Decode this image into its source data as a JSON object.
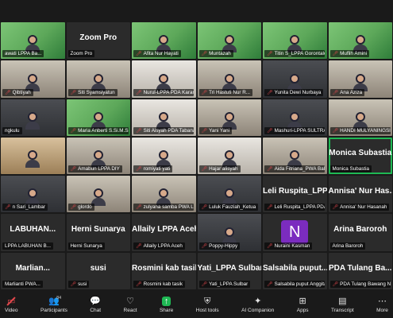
{
  "toolbar": {
    "video": "Video",
    "participants": "Participants",
    "participant_count": "84",
    "chat": "Chat",
    "react": "React",
    "share": "Share",
    "host_tools": "Host tools",
    "ai_companion": "AI Companion",
    "apps": "Apps",
    "transcript": "Transcript",
    "more": "More"
  },
  "tiles": [
    {
      "label": "awati LPPA Ba...",
      "muted": false,
      "style": "vid-green"
    },
    {
      "label": "Zoom Pro",
      "muted": false,
      "style": "text",
      "big": "Zoom Pro"
    },
    {
      "label": "Afita Nur Hayati",
      "muted": true,
      "style": "vid-green"
    },
    {
      "label": "Muntazah",
      "muted": true,
      "style": "vid-green"
    },
    {
      "label": "Titin S_LPPA Gorontalo",
      "muted": true,
      "style": "vid-green"
    },
    {
      "label": "Muflih Amini",
      "muted": true,
      "style": "vid-green"
    },
    {
      "label": "Qibtiyah",
      "muted": true,
      "style": "vid-room"
    },
    {
      "label": "Siti Syamsiyatun",
      "muted": true,
      "style": "vid-room"
    },
    {
      "label": "Nurul-LPPA PDA Karan...",
      "muted": true,
      "style": "vid-light"
    },
    {
      "label": "Tri Hastuti Nur R...",
      "muted": true,
      "style": "vid-room"
    },
    {
      "label": "Yunita Dewi Nurbaya",
      "muted": true,
      "style": "vid-dark"
    },
    {
      "label": "Ana Aziza",
      "muted": true,
      "style": "vid-room"
    },
    {
      "label": "ngkulu",
      "muted": false,
      "style": "vid-dark"
    },
    {
      "label": "Maria Anberti S.Si.M.Si",
      "muted": true,
      "style": "vid-green"
    },
    {
      "label": "Siti Aisyah PDA Tabana...",
      "muted": true,
      "style": "vid-light"
    },
    {
      "label": "Yani Yani",
      "muted": true,
      "style": "vid-room"
    },
    {
      "label": "Mashuri-LPPA SULTRA",
      "muted": true,
      "style": "vid-dark"
    },
    {
      "label": "HANDI MULYANINGSIH",
      "muted": true,
      "style": "vid-room"
    },
    {
      "label": "",
      "muted": false,
      "style": "vid-warm"
    },
    {
      "label": "Amabun LPPA DIY",
      "muted": true,
      "style": "vid-room"
    },
    {
      "label": "romiyati yati",
      "muted": true,
      "style": "vid-light"
    },
    {
      "label": "Hajar alisyah",
      "muted": true,
      "style": "vid-light"
    },
    {
      "label": "Aida Fitriana_PWA Bali",
      "muted": true,
      "style": "vid-room"
    },
    {
      "label": "Monica Subastia",
      "muted": false,
      "style": "active",
      "big": "Monica Subastia"
    },
    {
      "label": "n Sari_Lambar",
      "muted": true,
      "style": "vid-dark"
    },
    {
      "label": "glordo",
      "muted": true,
      "style": "vid-room"
    },
    {
      "label": "zulyana samba PWA L...",
      "muted": true,
      "style": "vid-room"
    },
    {
      "label": "Luluk Fauziah_Ketua",
      "muted": true,
      "style": "vid-dark"
    },
    {
      "label": "Leli Ruspita_LPPA PDA ...",
      "muted": true,
      "style": "text",
      "big": "Leli Ruspita_LPP..."
    },
    {
      "label": "Annisa' Nur Hasanah",
      "muted": true,
      "style": "text",
      "big": "Annisa' Nur Has..."
    },
    {
      "label": "LPPA LABUHAN B...",
      "muted": false,
      "style": "text",
      "big": "LABUHAN..."
    },
    {
      "label": "Herni Sunarya",
      "muted": false,
      "style": "text",
      "big": "Herni Sunarya"
    },
    {
      "label": "Allaily LPPA Aceh",
      "muted": true,
      "style": "text",
      "big": "Allaily LPPA Aceh"
    },
    {
      "label": "Poppy-Hippy",
      "muted": true,
      "style": "vid-dark"
    },
    {
      "label": "Nuraini Kasman",
      "muted": true,
      "style": "avatar",
      "avatar": "N"
    },
    {
      "label": "Arina Baroroh",
      "muted": false,
      "style": "text",
      "big": "Arina Baroroh"
    },
    {
      "label": "Marlianti PWA...",
      "muted": false,
      "style": "text",
      "big": "Marlian..."
    },
    {
      "label": "susi",
      "muted": true,
      "style": "text",
      "big": "susi"
    },
    {
      "label": "Rosmini kab tasik",
      "muted": true,
      "style": "text",
      "big": "Rosmini kab tasik"
    },
    {
      "label": "Yati_LPPA Sulbar",
      "muted": true,
      "style": "text",
      "big": "Yati_LPPA Sulbar"
    },
    {
      "label": "Salsabila puput Anggita",
      "muted": true,
      "style": "text",
      "big": "Salsabila puput..."
    },
    {
      "label": "PDA Tulang Bawang N...",
      "muted": true,
      "style": "text",
      "big": "PDA Tulang Ba..."
    }
  ]
}
